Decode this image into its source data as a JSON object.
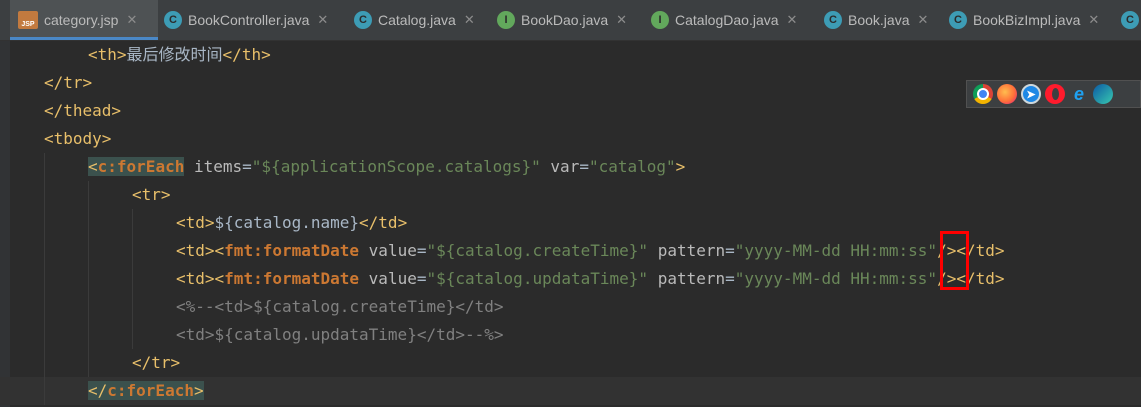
{
  "tabs": [
    {
      "label": "category.jsp",
      "icon": "jsp-file-icon",
      "icon_text": "JSP",
      "active": true
    },
    {
      "label": "BookController.java",
      "icon": "class-icon",
      "icon_text": "C"
    },
    {
      "label": "Catalog.java",
      "icon": "class-icon",
      "icon_text": "C"
    },
    {
      "label": "BookDao.java",
      "icon": "interface-icon",
      "icon_text": "I"
    },
    {
      "label": "CatalogDao.java",
      "icon": "interface-icon",
      "icon_text": "I"
    },
    {
      "label": "Book.java",
      "icon": "class-icon",
      "icon_text": "C"
    },
    {
      "label": "BookBizImpl.java",
      "icon": "class-icon",
      "icon_text": "C"
    }
  ],
  "close_glyph": "✕",
  "code": {
    "l1_text": "最后修改时间",
    "items_value": "\"${applicationScope.catalogs}\"",
    "var_value": "\"catalog\"",
    "name_expr": "${catalog.name}",
    "create_value": "\"${catalog.createTime}\"",
    "updata_value": "\"${catalog.updataTime}\"",
    "pattern_pre": "\"yyyy-MM-dd ",
    "pattern_hh": "HH",
    "pattern_post": ":mm:ss\"",
    "comment1": "<%--<td>${catalog.createTime}</td>",
    "comment2": "<td>${catalog.updataTime}</td>--%>"
  },
  "browsers": [
    "chrome-icon",
    "firefox-icon",
    "safari-icon",
    "opera-icon",
    "ie-icon",
    "edge-icon"
  ],
  "colors": {
    "accent": "#4a88c7",
    "highlight_box": "#ff0000"
  }
}
